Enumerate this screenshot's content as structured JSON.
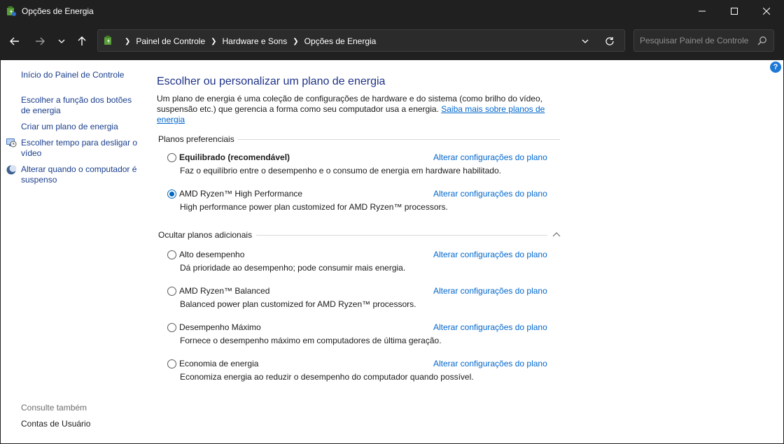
{
  "window": {
    "title": "Opções de Energia",
    "icon": "power-options-icon"
  },
  "address": {
    "crumbs": [
      "Painel de Controle",
      "Hardware e Sons",
      "Opções de Energia"
    ],
    "search_placeholder": "Pesquisar Painel de Controle"
  },
  "sidebar": {
    "links": [
      {
        "label": "Início do Painel de Controle"
      },
      {
        "label": "Escolher a função dos botões de energia"
      },
      {
        "label": "Criar um plano de energia"
      },
      {
        "label": "Escolher tempo para desligar o vídeo",
        "icon": "monitor-clock-icon"
      },
      {
        "label": "Alterar quando o computador é suspenso",
        "icon": "moon-icon"
      }
    ],
    "see_also_label": "Consulte também",
    "see_also_links": [
      {
        "label": "Contas de Usuário"
      }
    ]
  },
  "main": {
    "heading": "Escolher ou personalizar um plano de energia",
    "description": "Um plano de energia é uma coleção de configurações de hardware e do sistema (como brilho do vídeo, suspensão etc.) que gerencia a forma como seu computador usa a energia.",
    "learn_more_link": "Saiba mais sobre planos de energia",
    "preferred_group": "Planos preferenciais",
    "additional_group": "Ocultar planos adicionais",
    "change_link": "Alterar configurações do plano",
    "preferred_plans": [
      {
        "name": "Equilibrado (recomendável)",
        "description": "Faz o equilíbrio entre o desempenho e o consumo de energia em hardware habilitado.",
        "selected": false,
        "bold": true
      },
      {
        "name": "AMD Ryzen™ High Performance",
        "description": "High performance power plan customized for AMD Ryzen™ processors.",
        "selected": true,
        "bold": false
      }
    ],
    "additional_plans": [
      {
        "name": "Alto desempenho",
        "description": "Dá prioridade ao desempenho; pode consumir mais energia.",
        "selected": false
      },
      {
        "name": "AMD Ryzen™ Balanced",
        "description": "Balanced power plan customized for AMD Ryzen™ processors.",
        "selected": false
      },
      {
        "name": "Desempenho Máximo",
        "description": "Fornece o desempenho máximo em computadores de última geração.",
        "selected": false
      },
      {
        "name": "Economia de energia",
        "description": "Economiza energia ao reduzir o desempenho do computador quando possível.",
        "selected": false
      }
    ]
  },
  "help": {
    "label": "?"
  },
  "colors": {
    "titlebar_bg": "#202020",
    "link": "#0066cc",
    "sidebar_link": "#1a3e8c",
    "heading": "#1e3287",
    "radio_selected": "#0067c0"
  }
}
